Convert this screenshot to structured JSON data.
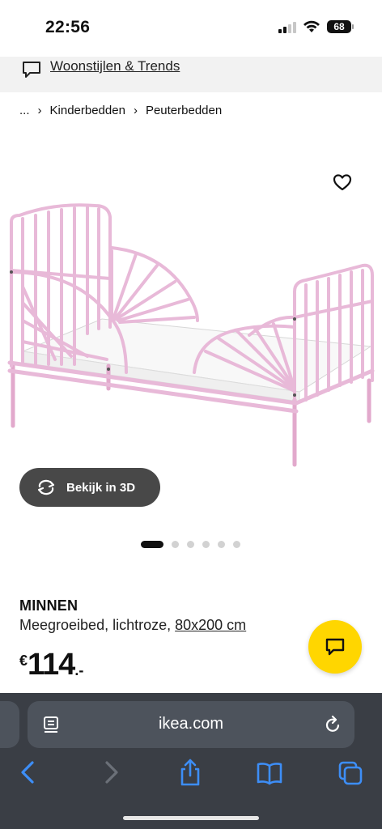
{
  "status_bar": {
    "time": "22:56",
    "battery": "68"
  },
  "banner": {
    "link": "Woonstijlen & Trends",
    "icon": "chat-bubble-icon"
  },
  "breadcrumb": {
    "ellipsis": "...",
    "separator": "›",
    "items": [
      "Kinderbedden",
      "Peuterbedden"
    ]
  },
  "product": {
    "image_alt": "MINNEN Meegroeibed, lichtroze",
    "view3d_label": "Bekijk in 3D",
    "name": "MINNEN",
    "description": "Meegroeibed, lichtroze,",
    "size": "80x200 cm",
    "price": {
      "currency": "€",
      "amount": "114",
      "decimals": ".-"
    },
    "gallery": {
      "count": 6,
      "active": 1
    }
  },
  "browser": {
    "url": "ikea.com"
  },
  "colors": {
    "bed_pink": "#e8b9d8",
    "fab_yellow": "#ffd600",
    "chrome": "#3a3e45",
    "ios_blue": "#3d8ef7"
  }
}
